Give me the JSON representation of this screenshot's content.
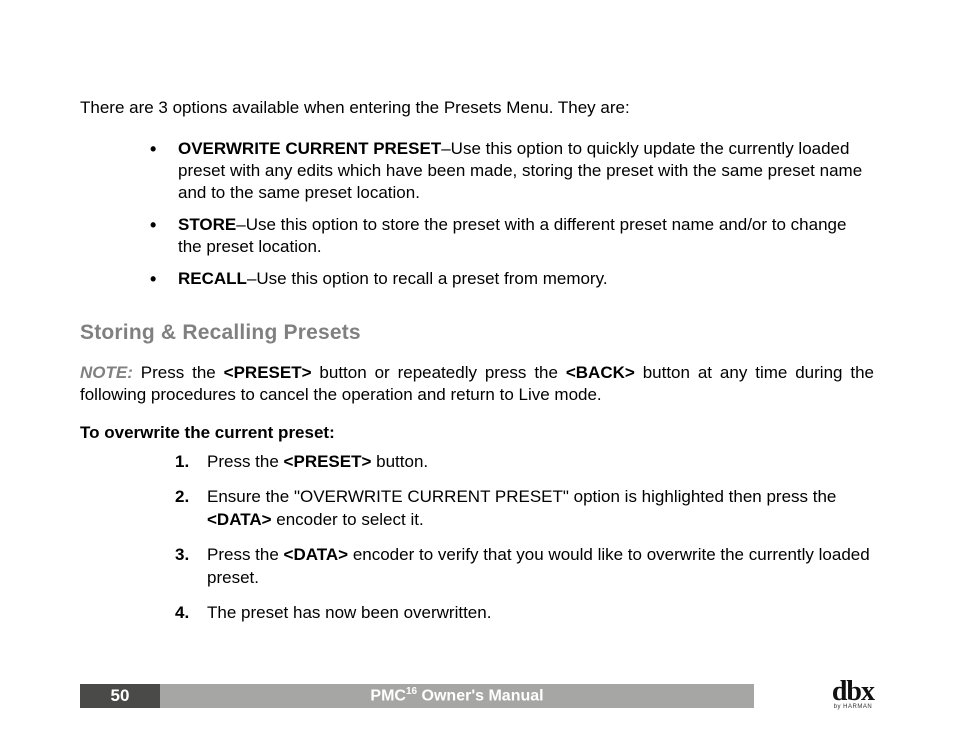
{
  "intro": "There are 3 options available when entering the Presets Menu. They are:",
  "bullets": [
    {
      "term": "OVERWRITE CURRENT PRESET",
      "desc": "–Use this option to quickly update the currently loaded preset with any edits which have been made, storing the preset with the same preset name and to the same preset location."
    },
    {
      "term": "STORE",
      "desc": "–Use this option to store the preset with a different preset name and/or to change the preset location."
    },
    {
      "term": "RECALL",
      "desc": "–Use this option to recall a preset from memory."
    }
  ],
  "section_heading": "Storing & Recalling Presets",
  "note": {
    "label": "NOTE:",
    "pre1": " Press the ",
    "btn1": "<PRESET>",
    "mid": " button or repeatedly press the ",
    "btn2": "<BACK>",
    "post": " button at any time during the following procedures to cancel the operation and return to Live mode."
  },
  "subhead": "To overwrite the current preset:",
  "steps": {
    "s1": {
      "a": "Press the ",
      "b": "<PRESET>",
      "c": " button."
    },
    "s2": {
      "a": "Ensure the \"OVERWRITE CURRENT PRESET\" option is highlighted then press the ",
      "b": "<DATA>",
      "c": " encoder to select it."
    },
    "s3": {
      "a": "Press the ",
      "b": "<DATA>",
      "c": " encoder to verify that you would like to overwrite the currently loaded preset."
    },
    "s4": {
      "a": "The preset has now been overwritten."
    }
  },
  "footer": {
    "page_number": "50",
    "product_prefix": "PMC",
    "product_super": "16",
    "manual_label": " Owner's Manual",
    "brand_main": "dbx",
    "brand_sub": "by HARMAN"
  }
}
